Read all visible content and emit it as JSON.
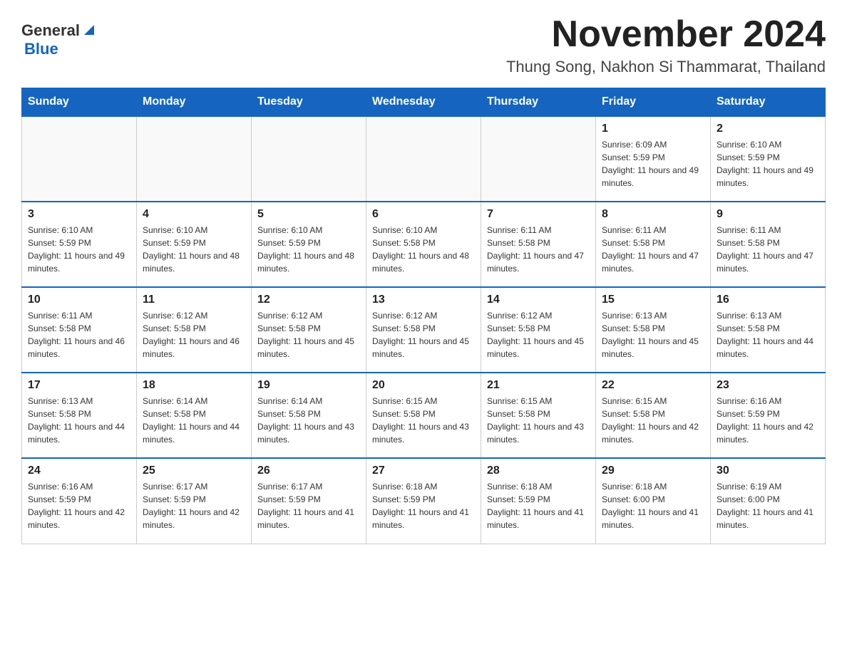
{
  "header": {
    "logo_general": "General",
    "logo_blue": "Blue",
    "month_title": "November 2024",
    "location": "Thung Song, Nakhon Si Thammarat, Thailand"
  },
  "weekdays": [
    "Sunday",
    "Monday",
    "Tuesday",
    "Wednesday",
    "Thursday",
    "Friday",
    "Saturday"
  ],
  "weeks": [
    [
      {
        "day": "",
        "info": ""
      },
      {
        "day": "",
        "info": ""
      },
      {
        "day": "",
        "info": ""
      },
      {
        "day": "",
        "info": ""
      },
      {
        "day": "",
        "info": ""
      },
      {
        "day": "1",
        "info": "Sunrise: 6:09 AM\nSunset: 5:59 PM\nDaylight: 11 hours and 49 minutes."
      },
      {
        "day": "2",
        "info": "Sunrise: 6:10 AM\nSunset: 5:59 PM\nDaylight: 11 hours and 49 minutes."
      }
    ],
    [
      {
        "day": "3",
        "info": "Sunrise: 6:10 AM\nSunset: 5:59 PM\nDaylight: 11 hours and 49 minutes."
      },
      {
        "day": "4",
        "info": "Sunrise: 6:10 AM\nSunset: 5:59 PM\nDaylight: 11 hours and 48 minutes."
      },
      {
        "day": "5",
        "info": "Sunrise: 6:10 AM\nSunset: 5:59 PM\nDaylight: 11 hours and 48 minutes."
      },
      {
        "day": "6",
        "info": "Sunrise: 6:10 AM\nSunset: 5:58 PM\nDaylight: 11 hours and 48 minutes."
      },
      {
        "day": "7",
        "info": "Sunrise: 6:11 AM\nSunset: 5:58 PM\nDaylight: 11 hours and 47 minutes."
      },
      {
        "day": "8",
        "info": "Sunrise: 6:11 AM\nSunset: 5:58 PM\nDaylight: 11 hours and 47 minutes."
      },
      {
        "day": "9",
        "info": "Sunrise: 6:11 AM\nSunset: 5:58 PM\nDaylight: 11 hours and 47 minutes."
      }
    ],
    [
      {
        "day": "10",
        "info": "Sunrise: 6:11 AM\nSunset: 5:58 PM\nDaylight: 11 hours and 46 minutes."
      },
      {
        "day": "11",
        "info": "Sunrise: 6:12 AM\nSunset: 5:58 PM\nDaylight: 11 hours and 46 minutes."
      },
      {
        "day": "12",
        "info": "Sunrise: 6:12 AM\nSunset: 5:58 PM\nDaylight: 11 hours and 45 minutes."
      },
      {
        "day": "13",
        "info": "Sunrise: 6:12 AM\nSunset: 5:58 PM\nDaylight: 11 hours and 45 minutes."
      },
      {
        "day": "14",
        "info": "Sunrise: 6:12 AM\nSunset: 5:58 PM\nDaylight: 11 hours and 45 minutes."
      },
      {
        "day": "15",
        "info": "Sunrise: 6:13 AM\nSunset: 5:58 PM\nDaylight: 11 hours and 45 minutes."
      },
      {
        "day": "16",
        "info": "Sunrise: 6:13 AM\nSunset: 5:58 PM\nDaylight: 11 hours and 44 minutes."
      }
    ],
    [
      {
        "day": "17",
        "info": "Sunrise: 6:13 AM\nSunset: 5:58 PM\nDaylight: 11 hours and 44 minutes."
      },
      {
        "day": "18",
        "info": "Sunrise: 6:14 AM\nSunset: 5:58 PM\nDaylight: 11 hours and 44 minutes."
      },
      {
        "day": "19",
        "info": "Sunrise: 6:14 AM\nSunset: 5:58 PM\nDaylight: 11 hours and 43 minutes."
      },
      {
        "day": "20",
        "info": "Sunrise: 6:15 AM\nSunset: 5:58 PM\nDaylight: 11 hours and 43 minutes."
      },
      {
        "day": "21",
        "info": "Sunrise: 6:15 AM\nSunset: 5:58 PM\nDaylight: 11 hours and 43 minutes."
      },
      {
        "day": "22",
        "info": "Sunrise: 6:15 AM\nSunset: 5:58 PM\nDaylight: 11 hours and 42 minutes."
      },
      {
        "day": "23",
        "info": "Sunrise: 6:16 AM\nSunset: 5:59 PM\nDaylight: 11 hours and 42 minutes."
      }
    ],
    [
      {
        "day": "24",
        "info": "Sunrise: 6:16 AM\nSunset: 5:59 PM\nDaylight: 11 hours and 42 minutes."
      },
      {
        "day": "25",
        "info": "Sunrise: 6:17 AM\nSunset: 5:59 PM\nDaylight: 11 hours and 42 minutes."
      },
      {
        "day": "26",
        "info": "Sunrise: 6:17 AM\nSunset: 5:59 PM\nDaylight: 11 hours and 41 minutes."
      },
      {
        "day": "27",
        "info": "Sunrise: 6:18 AM\nSunset: 5:59 PM\nDaylight: 11 hours and 41 minutes."
      },
      {
        "day": "28",
        "info": "Sunrise: 6:18 AM\nSunset: 5:59 PM\nDaylight: 11 hours and 41 minutes."
      },
      {
        "day": "29",
        "info": "Sunrise: 6:18 AM\nSunset: 6:00 PM\nDaylight: 11 hours and 41 minutes."
      },
      {
        "day": "30",
        "info": "Sunrise: 6:19 AM\nSunset: 6:00 PM\nDaylight: 11 hours and 41 minutes."
      }
    ]
  ]
}
